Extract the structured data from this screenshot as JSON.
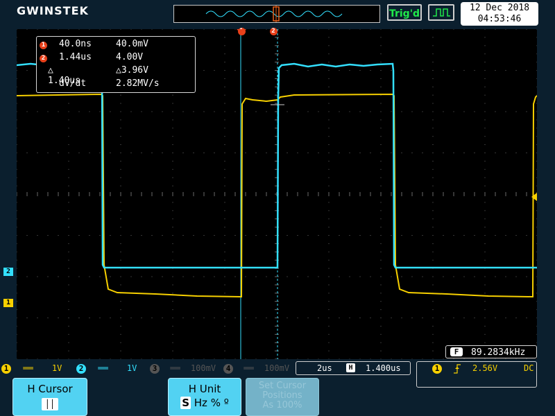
{
  "brand": {
    "logo": "GWINSTEK"
  },
  "status": {
    "trigger_state": "Trig'd",
    "date": "12 Dec 2018",
    "time": "04:53:46"
  },
  "readout": {
    "cursor1": {
      "time": "40.0ns",
      "volt": "40.0mV",
      "badge": "1"
    },
    "cursor2": {
      "time": "1.44us",
      "volt": "4.00V",
      "badge": "2"
    },
    "delta": {
      "time": "△ 1.40us",
      "volt": "△3.96V"
    },
    "slope": {
      "label": "dV/dt",
      "value": "2.82MV/s"
    }
  },
  "frequency": {
    "badge": "F",
    "value": "89.2834kHz"
  },
  "channels": [
    {
      "num": "1",
      "coupling": "══",
      "scale": "1V",
      "color": "#f7d000",
      "active": true
    },
    {
      "num": "2",
      "coupling": "══",
      "scale": "1V",
      "color": "#33e0ff",
      "active": true
    },
    {
      "num": "3",
      "coupling": "══",
      "scale": "100mV",
      "color": "#555555",
      "active": false
    },
    {
      "num": "4",
      "coupling": "══",
      "scale": "100mV",
      "color": "#555555",
      "active": false
    }
  ],
  "timebase": {
    "scale": "2us",
    "h_icon": "H",
    "position": "1.400us"
  },
  "trigger": {
    "source": "1",
    "slope_icon": "rising-edge-icon",
    "level": "2.56V",
    "coupling": "DC"
  },
  "softkeys": {
    "h_cursor": {
      "title": "H Cursor",
      "sub": "││"
    },
    "h_unit": {
      "title": "H Unit",
      "s": "S",
      "rest": "Hz % º"
    },
    "set_cursor": {
      "line1": "Set Cursor",
      "line2": "Positions",
      "line3": "As 100%"
    }
  },
  "markers": {
    "ch1": "1",
    "ch2": "2",
    "cursor1": "1",
    "cursor2": "2"
  },
  "colors": {
    "ch1": "#f7d000",
    "ch2": "#33e0ff",
    "cursor": "#e8401a",
    "grid": "#5a5a5a"
  }
}
